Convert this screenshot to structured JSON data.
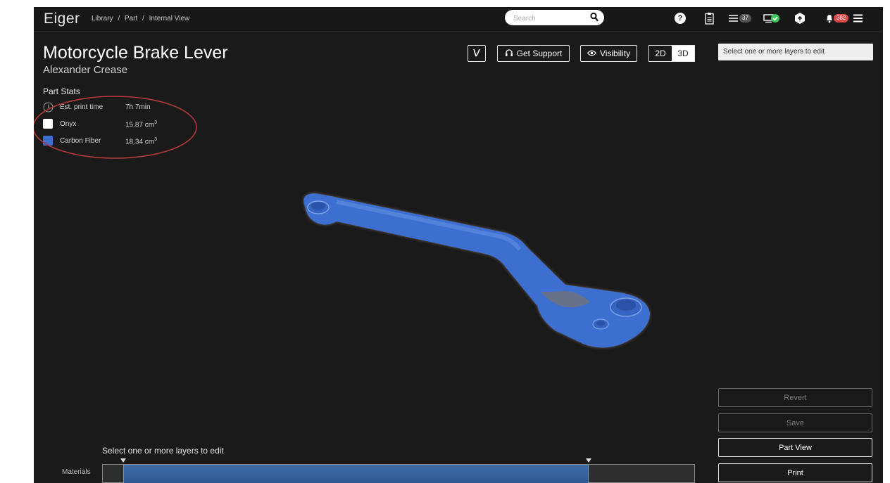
{
  "app": {
    "logo": "Eiger",
    "breadcrumb": [
      "Library",
      "/",
      "Part",
      "/",
      "Internal View"
    ],
    "search": {
      "placeholder": "Search"
    },
    "notifications": {
      "queue_count": "37",
      "alerts_count": "382"
    }
  },
  "part": {
    "title": "Motorcycle Brake Lever",
    "owner": "Alexander Crease"
  },
  "stats": {
    "heading": "Part Stats",
    "rows": [
      {
        "label": "Est. print time",
        "value": "7h 7min",
        "icon": "clock-icon"
      },
      {
        "label": "Onyx",
        "value": "15.87 cm",
        "unit_sup": "3",
        "color": "#ffffff"
      },
      {
        "label": "Carbon Fiber",
        "value": "18.34 cm",
        "unit_sup": "3",
        "color": "#3d6fd1"
      }
    ]
  },
  "toolbar": {
    "support_label": "Get Support",
    "visibility_label": "Visibility",
    "view_2d": "2D",
    "view_3d": "3D",
    "layer_select_text": "Select one or more layers to edit"
  },
  "actions": {
    "revert": "Revert",
    "save": "Save",
    "part_view": "Part View",
    "print": "Print"
  },
  "bottom": {
    "hint": "Select one or more layers to edit",
    "materials_label": "Materials"
  },
  "colors": {
    "background": "#1a1a1a",
    "model_blue": "#3d6fd1",
    "annotation_red": "#b03a3a"
  }
}
